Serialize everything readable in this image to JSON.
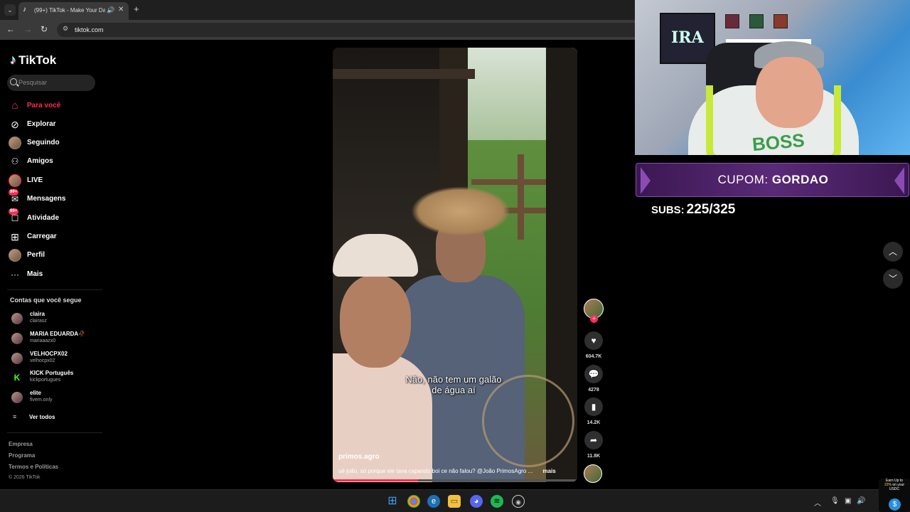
{
  "browser": {
    "tab_title": "(99+) TikTok - Make Your Da",
    "url": "tiktok.com"
  },
  "sidebar": {
    "logo": "TikTok",
    "search_placeholder": "Pesquisar",
    "nav": [
      {
        "label": "Para você",
        "icon": "home-icon",
        "active": true
      },
      {
        "label": "Explorar",
        "icon": "compass-icon"
      },
      {
        "label": "Seguindo",
        "icon": "following-avatar-icon"
      },
      {
        "label": "Amigos",
        "icon": "friends-icon"
      },
      {
        "label": "LIVE",
        "icon": "live-avatar-icon"
      },
      {
        "label": "Mensagens",
        "icon": "messages-icon",
        "badge": "99+"
      },
      {
        "label": "Atividade",
        "icon": "activity-icon",
        "badge": "99+"
      },
      {
        "label": "Carregar",
        "icon": "upload-icon"
      },
      {
        "label": "Perfil",
        "icon": "profile-avatar-icon"
      },
      {
        "label": "Mais",
        "icon": "more-icon"
      }
    ],
    "following_title": "Contas que você segue",
    "following": [
      {
        "name": "claira",
        "handle": "clairasz"
      },
      {
        "name": "MARIA EDUARDA🥀",
        "handle": "mariaaazx0"
      },
      {
        "name": "VELHOCPX02",
        "handle": "velhocpx02"
      },
      {
        "name": "KICK Português",
        "handle": "kickportugues"
      },
      {
        "name": "elite",
        "handle": "fivem.only"
      }
    ],
    "see_all": "Ver todos",
    "footer": [
      "Empresa",
      "Programa",
      "Termos e Políticas"
    ],
    "copyright": "© 2026 TikTok"
  },
  "video": {
    "subtitle_line1": "Não, não tem um galão",
    "subtitle_line2": "de água aí",
    "author": "primos.agro",
    "description": "ué joão, só porque ele tava capando boi ce não falou? @João PrimosAgro ...",
    "more": "mais",
    "progress": 0.35
  },
  "actions": {
    "likes": "604.7K",
    "comments": "4278",
    "saves": "14.2K",
    "shares": "11.8K"
  },
  "overlay": {
    "cupom_label": "CUPOM:",
    "cupom_code": "GORDAO",
    "subs_label": "SUBS:",
    "subs_value": "225/325",
    "poster_text": "IRA",
    "shirt_text": "BOSS"
  },
  "promo": {
    "line1": "Earn Up to",
    "highlight": "22%",
    "line2": "on your",
    "line3": "USDC"
  },
  "colors": {
    "accent": "#fe2c55",
    "cupom_bg": "#5a2a78",
    "progress_fill": "#fe2c55"
  }
}
